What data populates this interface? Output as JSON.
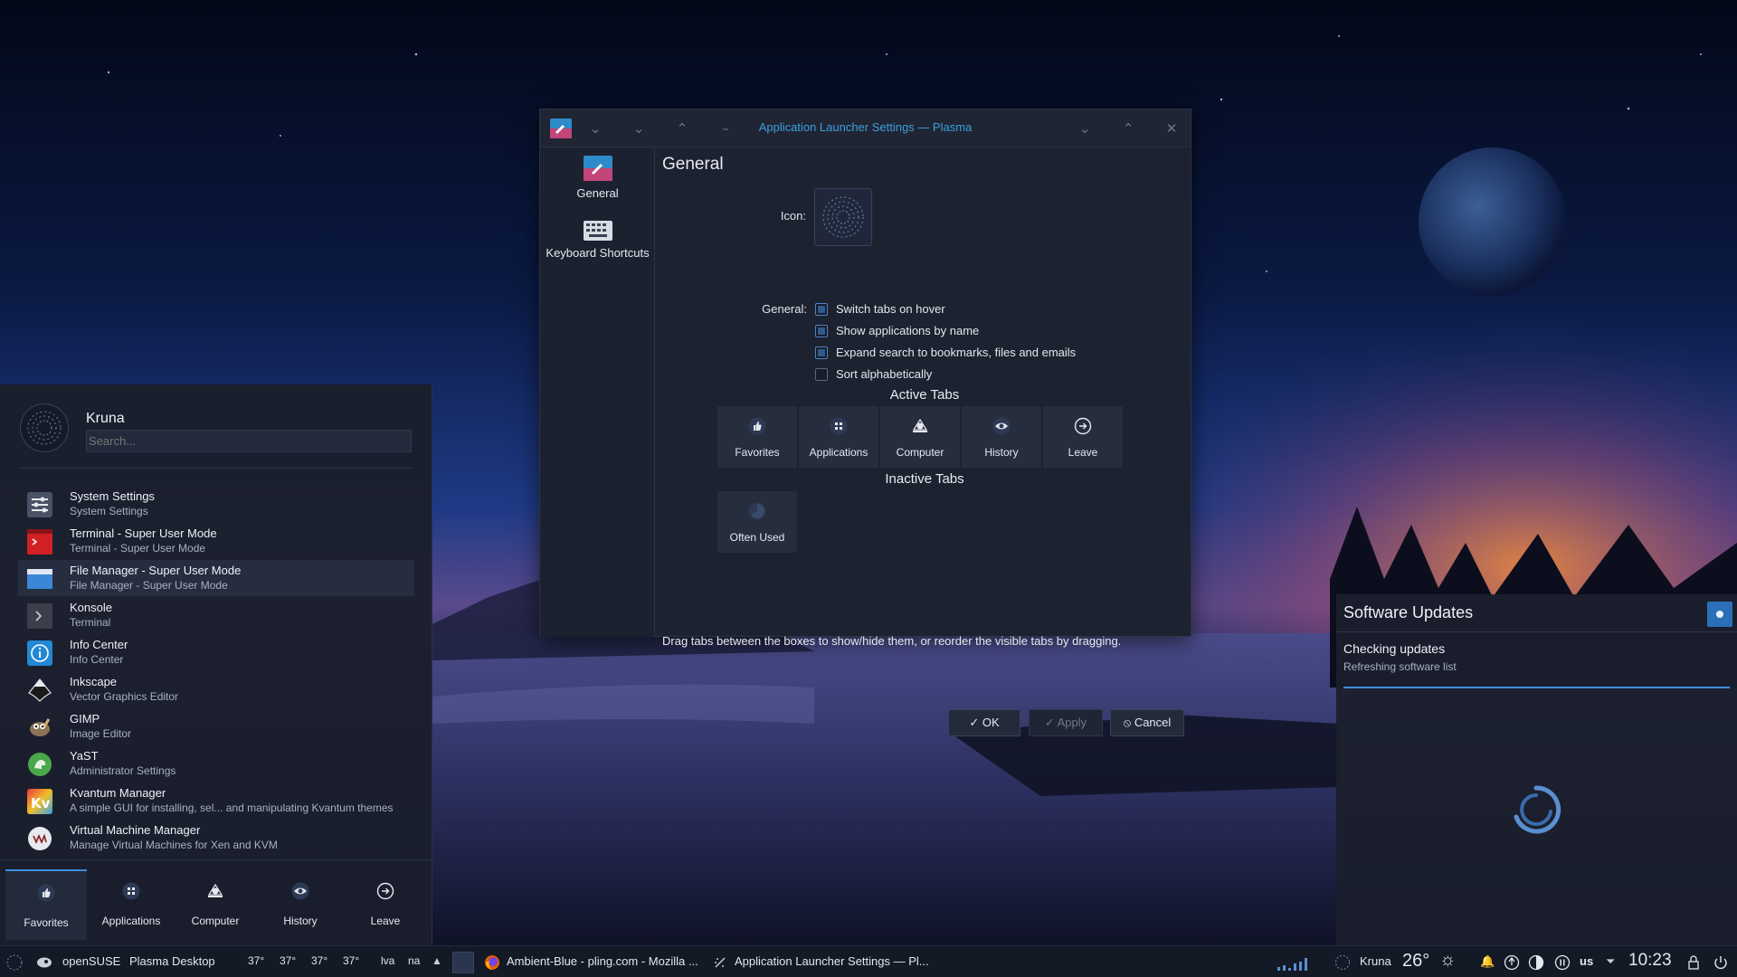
{
  "colors": {
    "accent": "#3d8ee0",
    "title_accent": "#3c9fe0",
    "panel": "#1d2230"
  },
  "dialog": {
    "title": "Application Launcher Settings — Plasma",
    "sidebar": [
      {
        "label": "General",
        "icon": "launcher-settings-icon"
      },
      {
        "label": "Keyboard Shortcuts",
        "icon": "keyboard-icon"
      }
    ],
    "heading": "General",
    "icon_label": "Icon:",
    "general_label": "General:",
    "options": [
      {
        "label": "Switch tabs on hover",
        "checked": true
      },
      {
        "label": "Show applications by name",
        "checked": true
      },
      {
        "label": "Expand search to bookmarks, files and emails",
        "checked": true
      },
      {
        "label": "Sort alphabetically",
        "checked": false
      }
    ],
    "active_tabs_title": "Active Tabs",
    "active_tabs": [
      {
        "label": "Favorites",
        "icon": "thumbs-up-icon"
      },
      {
        "label": "Applications",
        "icon": "app-grid-icon"
      },
      {
        "label": "Computer",
        "icon": "computer-icon"
      },
      {
        "label": "History",
        "icon": "eye-icon"
      },
      {
        "label": "Leave",
        "icon": "leave-icon"
      }
    ],
    "inactive_tabs_title": "Inactive Tabs",
    "inactive_tabs": [
      {
        "label": "Often Used",
        "icon": "pie-icon"
      }
    ],
    "hint": "Drag tabs between the boxes to show/hide them, or reorder the visible tabs by dragging.",
    "buttons": {
      "ok": "OK",
      "apply": "Apply",
      "cancel": "Cancel"
    }
  },
  "launcher": {
    "user": "Kruna",
    "search_placeholder": "Search...",
    "apps": [
      {
        "name": "System Settings",
        "desc": "System Settings",
        "icon": "settings-icon"
      },
      {
        "name": "Terminal - Super User Mode",
        "desc": "Terminal - Super User Mode",
        "icon": "terminal-icon"
      },
      {
        "name": "File Manager - Super User Mode",
        "desc": "File Manager - Super User Mode",
        "icon": "folder-icon"
      },
      {
        "name": "Konsole",
        "desc": "Terminal",
        "icon": "konsole-icon"
      },
      {
        "name": "Info Center",
        "desc": "Info Center",
        "icon": "info-icon"
      },
      {
        "name": "Inkscape",
        "desc": "Vector Graphics Editor",
        "icon": "inkscape-icon"
      },
      {
        "name": "GIMP",
        "desc": "Image Editor",
        "icon": "gimp-icon"
      },
      {
        "name": "YaST",
        "desc": "Administrator Settings",
        "icon": "yast-icon"
      },
      {
        "name": "Kvantum Manager",
        "desc": "A simple GUI for installing, sel... and manipulating Kvantum themes",
        "icon": "kvantum-icon"
      },
      {
        "name": "Virtual Machine Manager",
        "desc": "Manage Virtual Machines for Xen and KVM",
        "icon": "vm-icon"
      }
    ],
    "tabs": [
      {
        "label": "Favorites",
        "icon": "thumbs-up-icon",
        "selected": true
      },
      {
        "label": "Applications",
        "icon": "app-grid-icon"
      },
      {
        "label": "Computer",
        "icon": "computer-icon"
      },
      {
        "label": "History",
        "icon": "eye-icon"
      },
      {
        "label": "Leave",
        "icon": "leave-icon"
      }
    ]
  },
  "updates": {
    "title": "Software Updates",
    "status": "Checking updates",
    "substatus": "Refreshing software list"
  },
  "taskbar": {
    "distro": "openSUSE",
    "desktop": "Plasma Desktop",
    "temps": [
      "37°",
      "37°",
      "37°",
      "37°"
    ],
    "lva": "lva",
    "na": "na",
    "tasks": [
      {
        "label": "Ambient-Blue - pling.com - Mozilla ...",
        "icon": "firefox-icon"
      },
      {
        "label": "Application Launcher Settings — Pl...",
        "icon": "launcher-settings-icon"
      }
    ],
    "weather_user": "Kruna",
    "temperature": "26°",
    "keyboard_layout": "us",
    "clock": "10:23"
  }
}
